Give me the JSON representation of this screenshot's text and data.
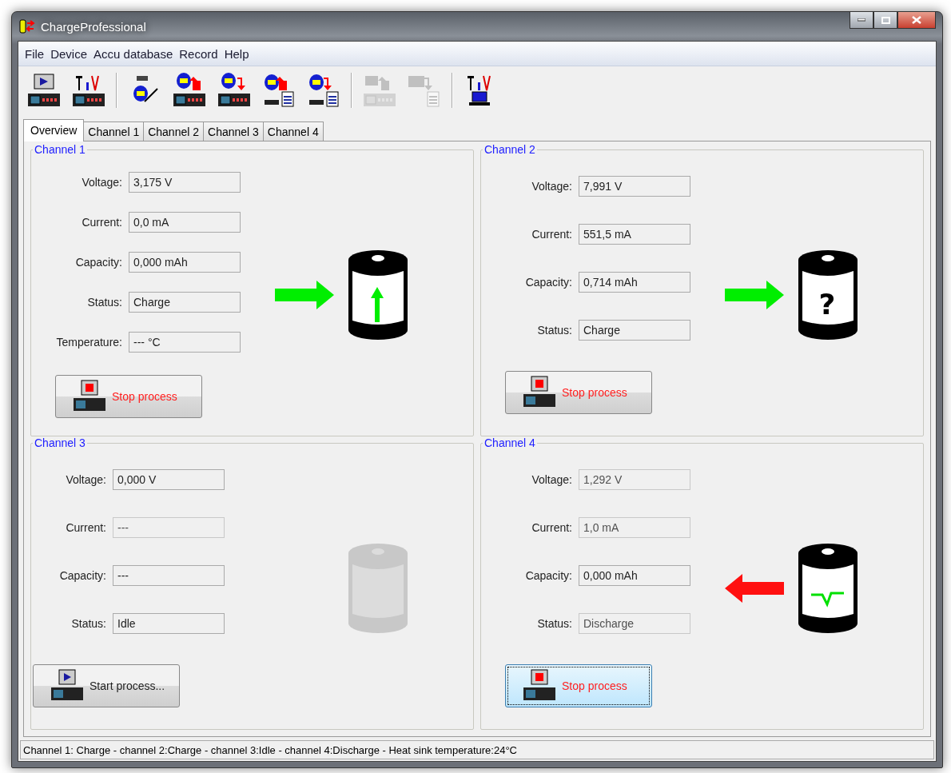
{
  "window": {
    "title": "ChargeProfessional"
  },
  "menu": [
    "File",
    "Device",
    "Accu database",
    "Record",
    "Help"
  ],
  "toolbar": [
    {
      "kind": "play-device",
      "disabled": false
    },
    {
      "kind": "tools-device",
      "disabled": false
    },
    {
      "kind": "separator"
    },
    {
      "kind": "db-edit",
      "disabled": false
    },
    {
      "kind": "db-to-device",
      "disabled": false
    },
    {
      "kind": "device-to-db",
      "disabled": false
    },
    {
      "kind": "db-from-file",
      "disabled": false
    },
    {
      "kind": "db-to-file",
      "disabled": false
    },
    {
      "kind": "separator"
    },
    {
      "kind": "pc-from-device",
      "disabled": true
    },
    {
      "kind": "pc-to-file",
      "disabled": true
    },
    {
      "kind": "separator"
    },
    {
      "kind": "tools-pc",
      "disabled": false
    }
  ],
  "tabs": [
    {
      "label": "Overview",
      "selected": true
    },
    {
      "label": "Channel 1",
      "selected": false
    },
    {
      "label": "Channel 2",
      "selected": false
    },
    {
      "label": "Channel 3",
      "selected": false
    },
    {
      "label": "Channel 4",
      "selected": false
    }
  ],
  "channels": [
    {
      "title": "Channel 1",
      "fields": [
        {
          "label": "Voltage:",
          "value": "3,175 V",
          "disabled": false
        },
        {
          "label": "Current:",
          "value": "0,0 mA",
          "disabled": false
        },
        {
          "label": "Capacity:",
          "value": "0,000 mAh",
          "disabled": false
        },
        {
          "label": "Status:",
          "value": "Charge",
          "disabled": false
        },
        {
          "label": "Temperature:",
          "value": "--- °C",
          "disabled": false
        }
      ],
      "arrow": {
        "kind": "in"
      },
      "battery": {
        "kind": "charge"
      },
      "button": {
        "kind": "stop",
        "label": "Stop process",
        "focused": false
      }
    },
    {
      "title": "Channel 2",
      "fields": [
        {
          "label": "Voltage:",
          "value": "7,991 V",
          "disabled": false
        },
        {
          "label": "Current:",
          "value": "551,5 mA",
          "disabled": false
        },
        {
          "label": "Capacity:",
          "value": "0,714 mAh",
          "disabled": false
        },
        {
          "label": "Status:",
          "value": "Charge",
          "disabled": false
        }
      ],
      "arrow": {
        "kind": "in"
      },
      "battery": {
        "kind": "unknown",
        "symbol": "?"
      },
      "button": {
        "kind": "stop",
        "label": "Stop process",
        "focused": false
      }
    },
    {
      "title": "Channel 3",
      "fields": [
        {
          "label": "Voltage:",
          "value": "0,000 V",
          "disabled": false
        },
        {
          "label": "Current:",
          "value": "---",
          "disabled": true
        },
        {
          "label": "Capacity:",
          "value": "---",
          "disabled": false
        },
        {
          "label": "Status:",
          "value": "Idle",
          "disabled": false
        }
      ],
      "arrow": {
        "kind": "none"
      },
      "battery": {
        "kind": "idle"
      },
      "button": {
        "kind": "start",
        "label": "Start process...",
        "focused": false
      }
    },
    {
      "title": "Channel 4",
      "fields": [
        {
          "label": "Voltage:",
          "value": "1,292 V",
          "disabled": true
        },
        {
          "label": "Current:",
          "value": "1,0 mA",
          "disabled": true
        },
        {
          "label": "Capacity:",
          "value": "0,000 mAh",
          "disabled": false
        },
        {
          "label": "Status:",
          "value": "Discharge",
          "disabled": true
        }
      ],
      "arrow": {
        "kind": "out"
      },
      "battery": {
        "kind": "discharge"
      },
      "button": {
        "kind": "stop",
        "label": "Stop process",
        "focused": true
      }
    }
  ],
  "status_bar": "Channel 1: Charge - channel 2:Charge - channel 3:Idle - channel 4:Discharge - Heat sink temperature:24°C"
}
